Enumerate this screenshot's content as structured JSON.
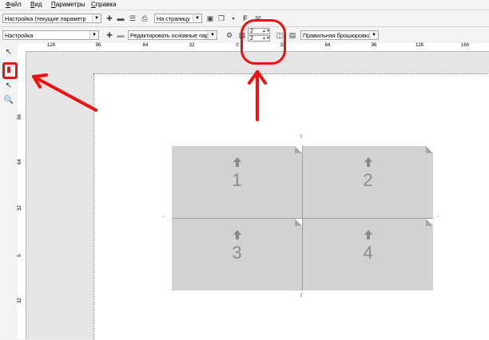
{
  "menu": [
    "Файл",
    "Вид",
    "Параметры",
    "Справка"
  ],
  "toolbar1": {
    "preset_combo": "Настройка (текущие параметр",
    "fit_combo": "На страницу",
    "font_glyph": "F"
  },
  "toolbar2": {
    "settings_combo": "Настройка",
    "edit_combo": "Редактировать основные пара",
    "rows_value": "2",
    "cols_value": "2",
    "imposition_combo": "Правильная брошюровка"
  },
  "ruler": {
    "h_labels": [
      "128",
      "96",
      "64",
      "32",
      "0",
      "32",
      "64",
      "96",
      "128",
      "160"
    ],
    "v_labels": [
      "96",
      "64",
      "32",
      "0",
      "32"
    ]
  },
  "pages": [
    "1",
    "2",
    "3",
    "4"
  ],
  "annotation_color": "#f01010"
}
